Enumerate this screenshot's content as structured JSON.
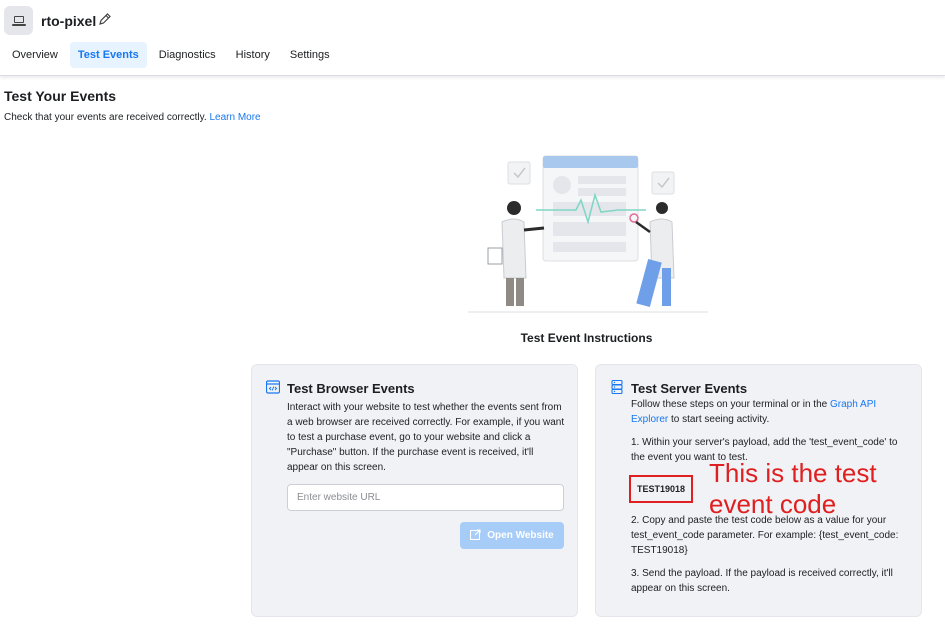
{
  "header": {
    "pixel_name": "rto-pixel",
    "tabs": [
      {
        "label": "Overview",
        "active": false
      },
      {
        "label": "Test Events",
        "active": true
      },
      {
        "label": "Diagnostics",
        "active": false
      },
      {
        "label": "History",
        "active": false
      },
      {
        "label": "Settings",
        "active": false
      }
    ]
  },
  "page": {
    "title": "Test Your Events",
    "subtitle": "Check that your events are received correctly.",
    "learn_more": "Learn More",
    "instructions_title": "Test Event Instructions"
  },
  "browser_card": {
    "title": "Test Browser Events",
    "description": "Interact with your website to test whether the events sent from a web browser are received correctly. For example, if you want to test a purchase event, go to your website and click a \"Purchase\" button. If the purchase event is received, it'll appear on this screen.",
    "url_placeholder": "Enter website URL",
    "url_value": "",
    "open_button": "Open Website"
  },
  "server_card": {
    "title": "Test Server Events",
    "intro_before": "Follow these steps on your terminal or in the",
    "intro_link": "Graph API Explorer",
    "intro_after": "to start seeing activity.",
    "step1": "1. Within your server's payload, add the 'test_event_code' to the event you want to test.",
    "test_code": "TEST19018",
    "step2": "2. Copy and paste the test code below as a value for your test_event_code parameter. For example: {test_event_code: TEST19018}",
    "step3": "3. Send the payload. If the payload is received correctly, it'll appear on this screen."
  },
  "annotation": {
    "text": "This is the test event code"
  },
  "colors": {
    "accent": "#1877f2",
    "tab_active_bg": "#e7f3ff",
    "card_bg": "#f0f2f5",
    "annotation_red": "#e02020",
    "button_disabled": "#a6ccf7"
  },
  "icons": {
    "pixel": "laptop-icon",
    "edit": "pencil-icon",
    "browser": "browser-code-icon",
    "server": "server-icon",
    "open": "external-link-icon"
  }
}
